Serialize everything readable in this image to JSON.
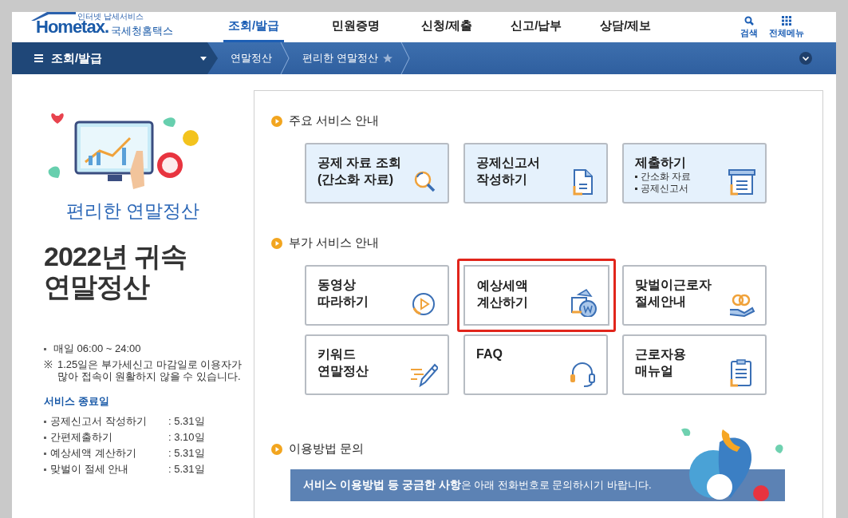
{
  "header": {
    "logo_tagline": "인터넷 납세서비스",
    "logo": "Hometax.",
    "logo_korean": "국세청홈택스",
    "nav": [
      {
        "label": "조회/발급",
        "selected": true
      },
      {
        "label": "민원증명",
        "selected": false
      },
      {
        "label": "신청/제출",
        "selected": false
      },
      {
        "label": "신고/납부",
        "selected": false
      },
      {
        "label": "상담/제보",
        "selected": false
      }
    ],
    "utilities": [
      {
        "label": "검색",
        "kind": "search"
      },
      {
        "label": "전체메뉴",
        "kind": "grid"
      }
    ]
  },
  "breadcrumb": {
    "menu": "조회/발급",
    "crumbs": [
      {
        "label": "연말정산",
        "star": false
      },
      {
        "label": "편리한 연말정산",
        "star": true
      }
    ]
  },
  "sidebar": {
    "subtitle": "편리한 연말정산",
    "title_lines": [
      "2022년 귀속",
      "연말정산"
    ],
    "hours": "매일 06:00  ~ 24:00",
    "notice_mark": "※",
    "notice": "1.25일은 부가세신고 마감일로 이용자가 많아 접속이 원활하지 않을 수 있습니다.",
    "end_dates_title": "서비스 종료일",
    "end_dates": [
      {
        "name": "공제신고서 작성하기",
        "date": ": 5.31일"
      },
      {
        "name": "간편제출하기",
        "date": ": 3.10일"
      },
      {
        "name": "예상세액 계산하기",
        "date": ": 5.31일"
      },
      {
        "name": "맞벌이 절세 안내",
        "date": ": 5.31일"
      }
    ]
  },
  "sections": [
    {
      "title": "주요 서비스 안내",
      "kind": "primary",
      "cards": [
        {
          "lines": [
            "공제 자료 조회",
            "(간소화 자료)"
          ],
          "kind": "search",
          "highlighted": false
        },
        {
          "lines": [
            "공제신고서",
            "작성하기"
          ],
          "kind": "document",
          "highlighted": false
        },
        {
          "lines": [
            "제출하기"
          ],
          "bullets": [
            "간소화 자료",
            "공제신고서"
          ],
          "kind": "tray",
          "highlighted": false
        }
      ]
    },
    {
      "title": "부가 서비스 안내",
      "kind": "plain",
      "cards": [
        {
          "lines": [
            "동영상",
            "따라하기"
          ],
          "kind": "play",
          "highlighted": false
        },
        {
          "lines": [
            "예상세액",
            "계산하기"
          ],
          "kind": "bag",
          "highlighted": true
        },
        {
          "lines": [
            "맞벌이근로자",
            "절세안내"
          ],
          "kind": "hand",
          "highlighted": false
        },
        {
          "lines": [
            "키워드",
            "연말정산"
          ],
          "kind": "pencil",
          "highlighted": false
        },
        {
          "lines": [
            "FAQ"
          ],
          "kind": "headset",
          "highlighted": false
        },
        {
          "lines": [
            "근로자용",
            "매뉴얼"
          ],
          "kind": "manual",
          "highlighted": false
        }
      ]
    }
  ],
  "contact": {
    "title": "이용방법 문의",
    "banner": "**서비스 이용방법 등 궁금한 사항**은 아래 전화번호로 문의하시기 바랍니다."
  }
}
